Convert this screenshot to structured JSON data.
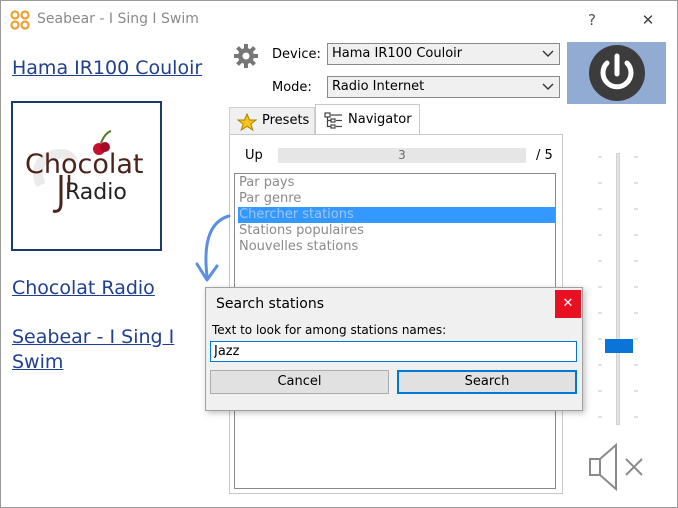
{
  "window": {
    "title": "Seabear - I Sing I Swim",
    "help_label": "?",
    "close_label": "✕"
  },
  "left_panel": {
    "device_link": "Hama IR100 Couloir",
    "station_link": "Chocolat Radio",
    "app_link": "Seabear - I Sing I Swim",
    "logo": {
      "word1": "Chocolat",
      "word2": "Radio",
      "colors": {
        "chocolate": "#4a2418",
        "cherry": "#c8102e"
      }
    }
  },
  "controls": {
    "device_label": "Device:",
    "device_value": "Hama IR100 Couloir",
    "mode_label": "Mode:",
    "mode_value": "Radio Internet",
    "power_color": "#91abd2"
  },
  "tabs": [
    {
      "label": "Presets",
      "icon": "star-icon",
      "active": false
    },
    {
      "label": "Navigator",
      "icon": "tree-icon",
      "active": true
    }
  ],
  "navigator": {
    "up_label": "Up",
    "current_page": "3",
    "total_pages": "/ 5",
    "items": [
      "Par pays",
      "Par genre",
      "Chercher stations",
      "Stations populaires",
      "Nouvelles stations"
    ],
    "selected_index": 2
  },
  "volume": {
    "level": 0.3,
    "thumb_color": "#0b74d8",
    "muted_icon": "speaker-mute-icon"
  },
  "dialog": {
    "title": "Search stations",
    "close_label": "✕",
    "prompt": "Text to look for among stations names:",
    "input_value": "Jazz",
    "cancel_label": "Cancel",
    "search_label": "Search"
  },
  "colors": {
    "link": "#1f3f8f",
    "selection": "#3399ff",
    "dialog_close": "#e81123",
    "focus": "#0078d7",
    "annotation_arrow": "#5b8fe0"
  }
}
